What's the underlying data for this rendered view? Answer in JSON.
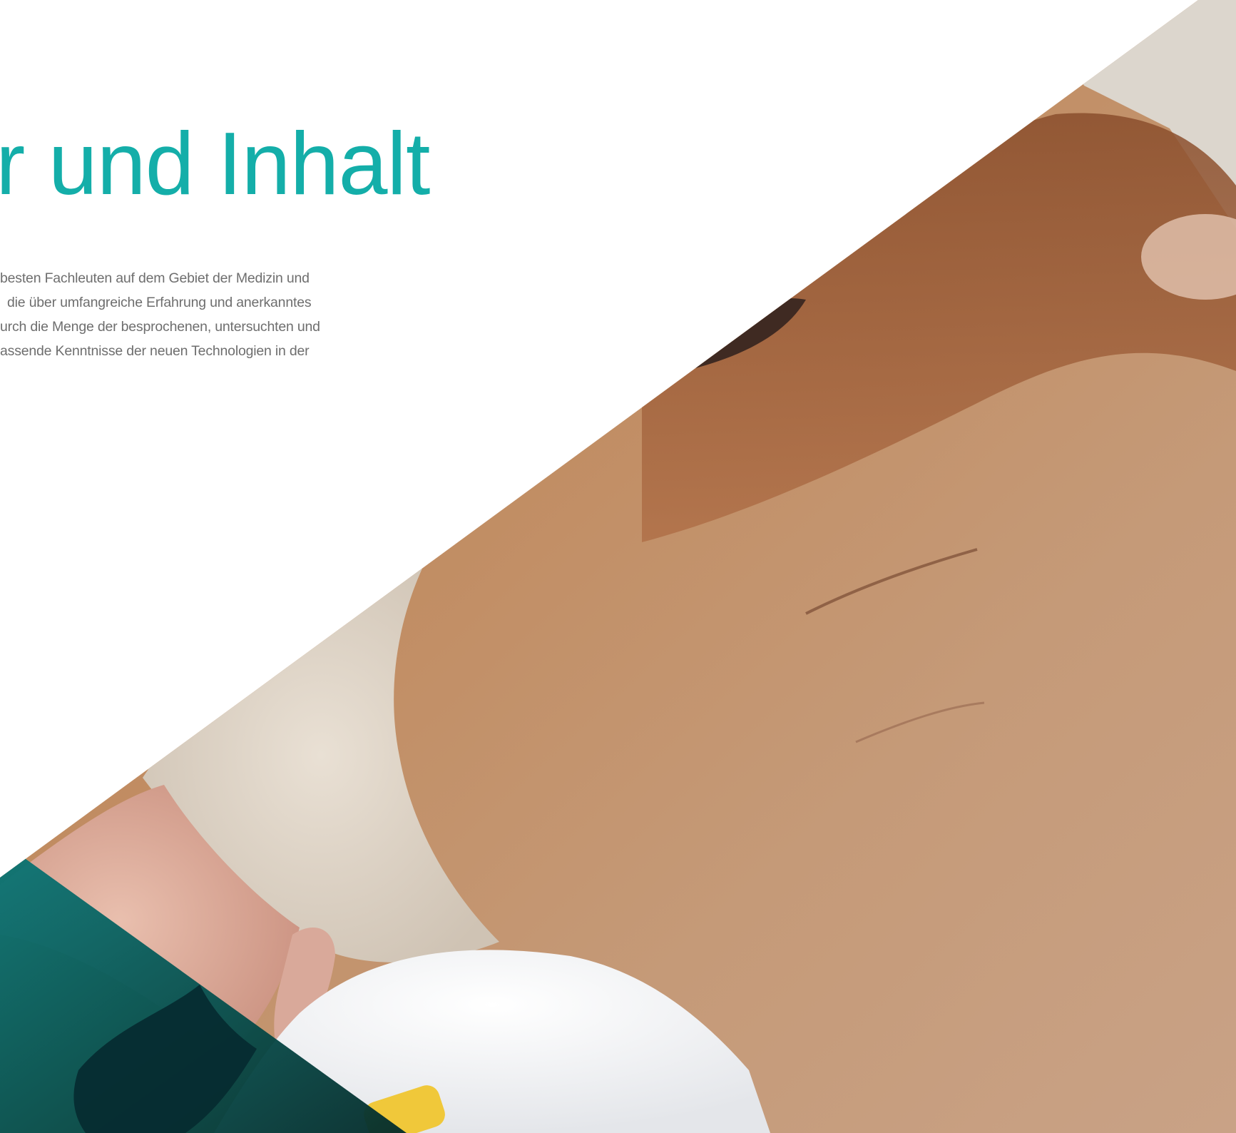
{
  "hero": {
    "title": "r und Inhalt",
    "body_lines": [
      "besten Fachleuten auf dem Gebiet der Medizin und",
      "die über umfangreiche Erfahrung und anerkanntes",
      "urch die Menge der besprochenen, untersuchten und",
      "assende Kenntnisse der neuen Technologien in der"
    ],
    "accent_color": "#14aea9"
  },
  "photo": {
    "subject": "brown-dog-lying-on-white-blanket-with-human-hand"
  }
}
